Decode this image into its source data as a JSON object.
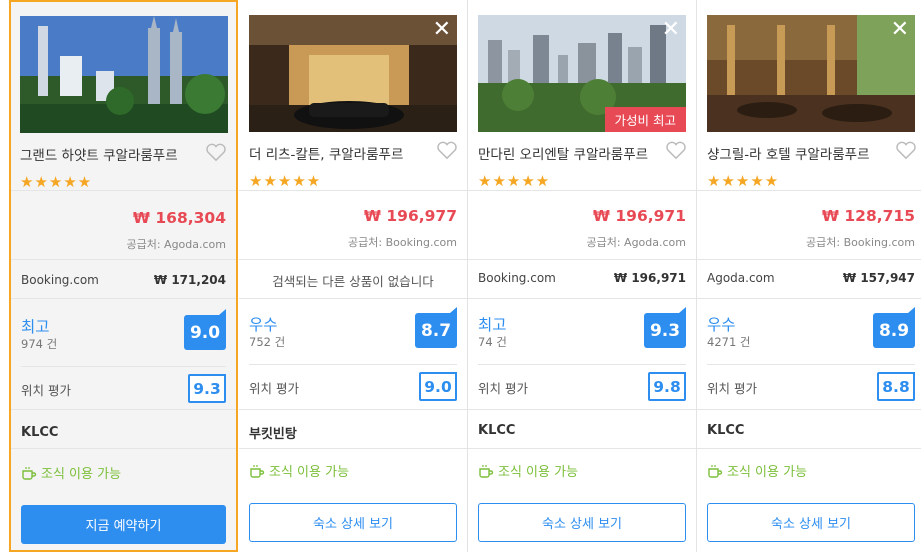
{
  "colors": {
    "accent": "#2d8ef0",
    "price": "#e84a55",
    "star": "#f5a623",
    "breakfast": "#7bbf3a",
    "selected_border": "#f5a623"
  },
  "hotels": [
    {
      "name": "그랜드 하얏트 쿠알라룸푸르",
      "stars": "★★★★★",
      "price": "₩ 168,304",
      "supplier": "공급처: Agoda.com",
      "other_source": "Booking.com",
      "other_price": "₩ 171,204",
      "rating_word": "최고",
      "review_count": "974 건",
      "rating": "9.0",
      "location_label": "위치 평가",
      "location_score": "9.3",
      "area": "KLCC",
      "breakfast": "조식 이용 가능",
      "button": "지금 예약하기"
    },
    {
      "name": "더 리츠-칼튼, 쿠알라룸푸르",
      "stars": "★★★★★",
      "price": "₩ 196,977",
      "supplier": "공급처: Booking.com",
      "no_other": "검색되는 다른 상품이 없습니다",
      "rating_word": "우수",
      "review_count": "752 건",
      "rating": "8.7",
      "location_label": "위치 평가",
      "location_score": "9.0",
      "area": "부킷빈탕",
      "breakfast": "조식 이용 가능",
      "button": "숙소 상세 보기",
      "close": "✕"
    },
    {
      "name": "만다린 오리엔탈 쿠알라룸푸르",
      "stars": "★★★★★",
      "tag": "가성비 최고",
      "price": "₩ 196,971",
      "supplier": "공급처: Agoda.com",
      "other_source": "Booking.com",
      "other_price": "₩ 196,971",
      "rating_word": "최고",
      "review_count": "74 건",
      "rating": "9.3",
      "location_label": "위치 평가",
      "location_score": "9.8",
      "area": "KLCC",
      "breakfast": "조식 이용 가능",
      "button": "숙소 상세 보기",
      "close": "✕"
    },
    {
      "name": "샹그릴-라 호텔 쿠알라룸푸르",
      "stars": "★★★★★",
      "price": "₩ 128,715",
      "supplier": "공급처: Booking.com",
      "other_source": "Agoda.com",
      "other_price": "₩ 157,947",
      "rating_word": "우수",
      "review_count": "4271 건",
      "rating": "8.9",
      "location_label": "위치 평가",
      "location_score": "8.8",
      "area": "KLCC",
      "breakfast": "조식 이용 가능",
      "button": "숙소 상세 보기",
      "close": "✕"
    }
  ]
}
